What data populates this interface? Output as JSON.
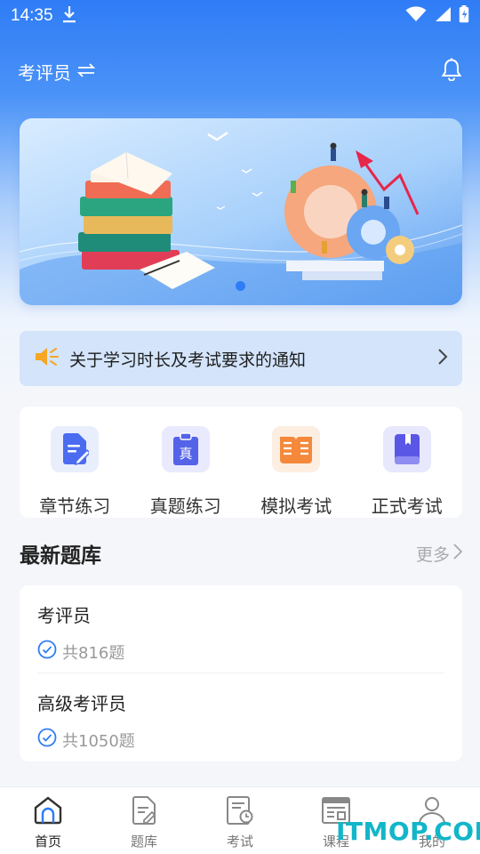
{
  "status_bar": {
    "time": "14:35"
  },
  "header": {
    "role_label": "考评员",
    "switch_icon": "swap-icon",
    "bell_icon": "bell-icon"
  },
  "banner": {
    "illustration": "books-and-gears"
  },
  "notice": {
    "text": "关于学习时长及考试要求的通知",
    "icon": "speaker-icon"
  },
  "entries": [
    {
      "label": "章节练习",
      "icon": "chapter-practice-icon",
      "color": "#4b6cf0"
    },
    {
      "label": "真题练习",
      "icon": "real-exam-icon",
      "color": "#5563e8"
    },
    {
      "label": "模拟考试",
      "icon": "mock-exam-icon",
      "color": "#f5893b"
    },
    {
      "label": "正式考试",
      "icon": "formal-exam-icon",
      "color": "#5b57e6"
    }
  ],
  "section": {
    "title": "最新题库",
    "more_label": "更多"
  },
  "banks": [
    {
      "name": "考评员",
      "count": "共816题"
    },
    {
      "name": "高级考评员",
      "count": "共1050题"
    }
  ],
  "tabbar": [
    {
      "label": "首页",
      "icon": "home-icon",
      "active": true
    },
    {
      "label": "题库",
      "icon": "question-bank-icon"
    },
    {
      "label": "考试",
      "icon": "exam-icon"
    },
    {
      "label": "课程",
      "icon": "course-icon"
    },
    {
      "label": "我的",
      "icon": "profile-icon"
    }
  ],
  "watermark": "ITMOP.COM",
  "colors": {
    "primary": "#2f7cf6",
    "notice_bg": "#d3e4fb",
    "watermark": "#12b6c9"
  }
}
